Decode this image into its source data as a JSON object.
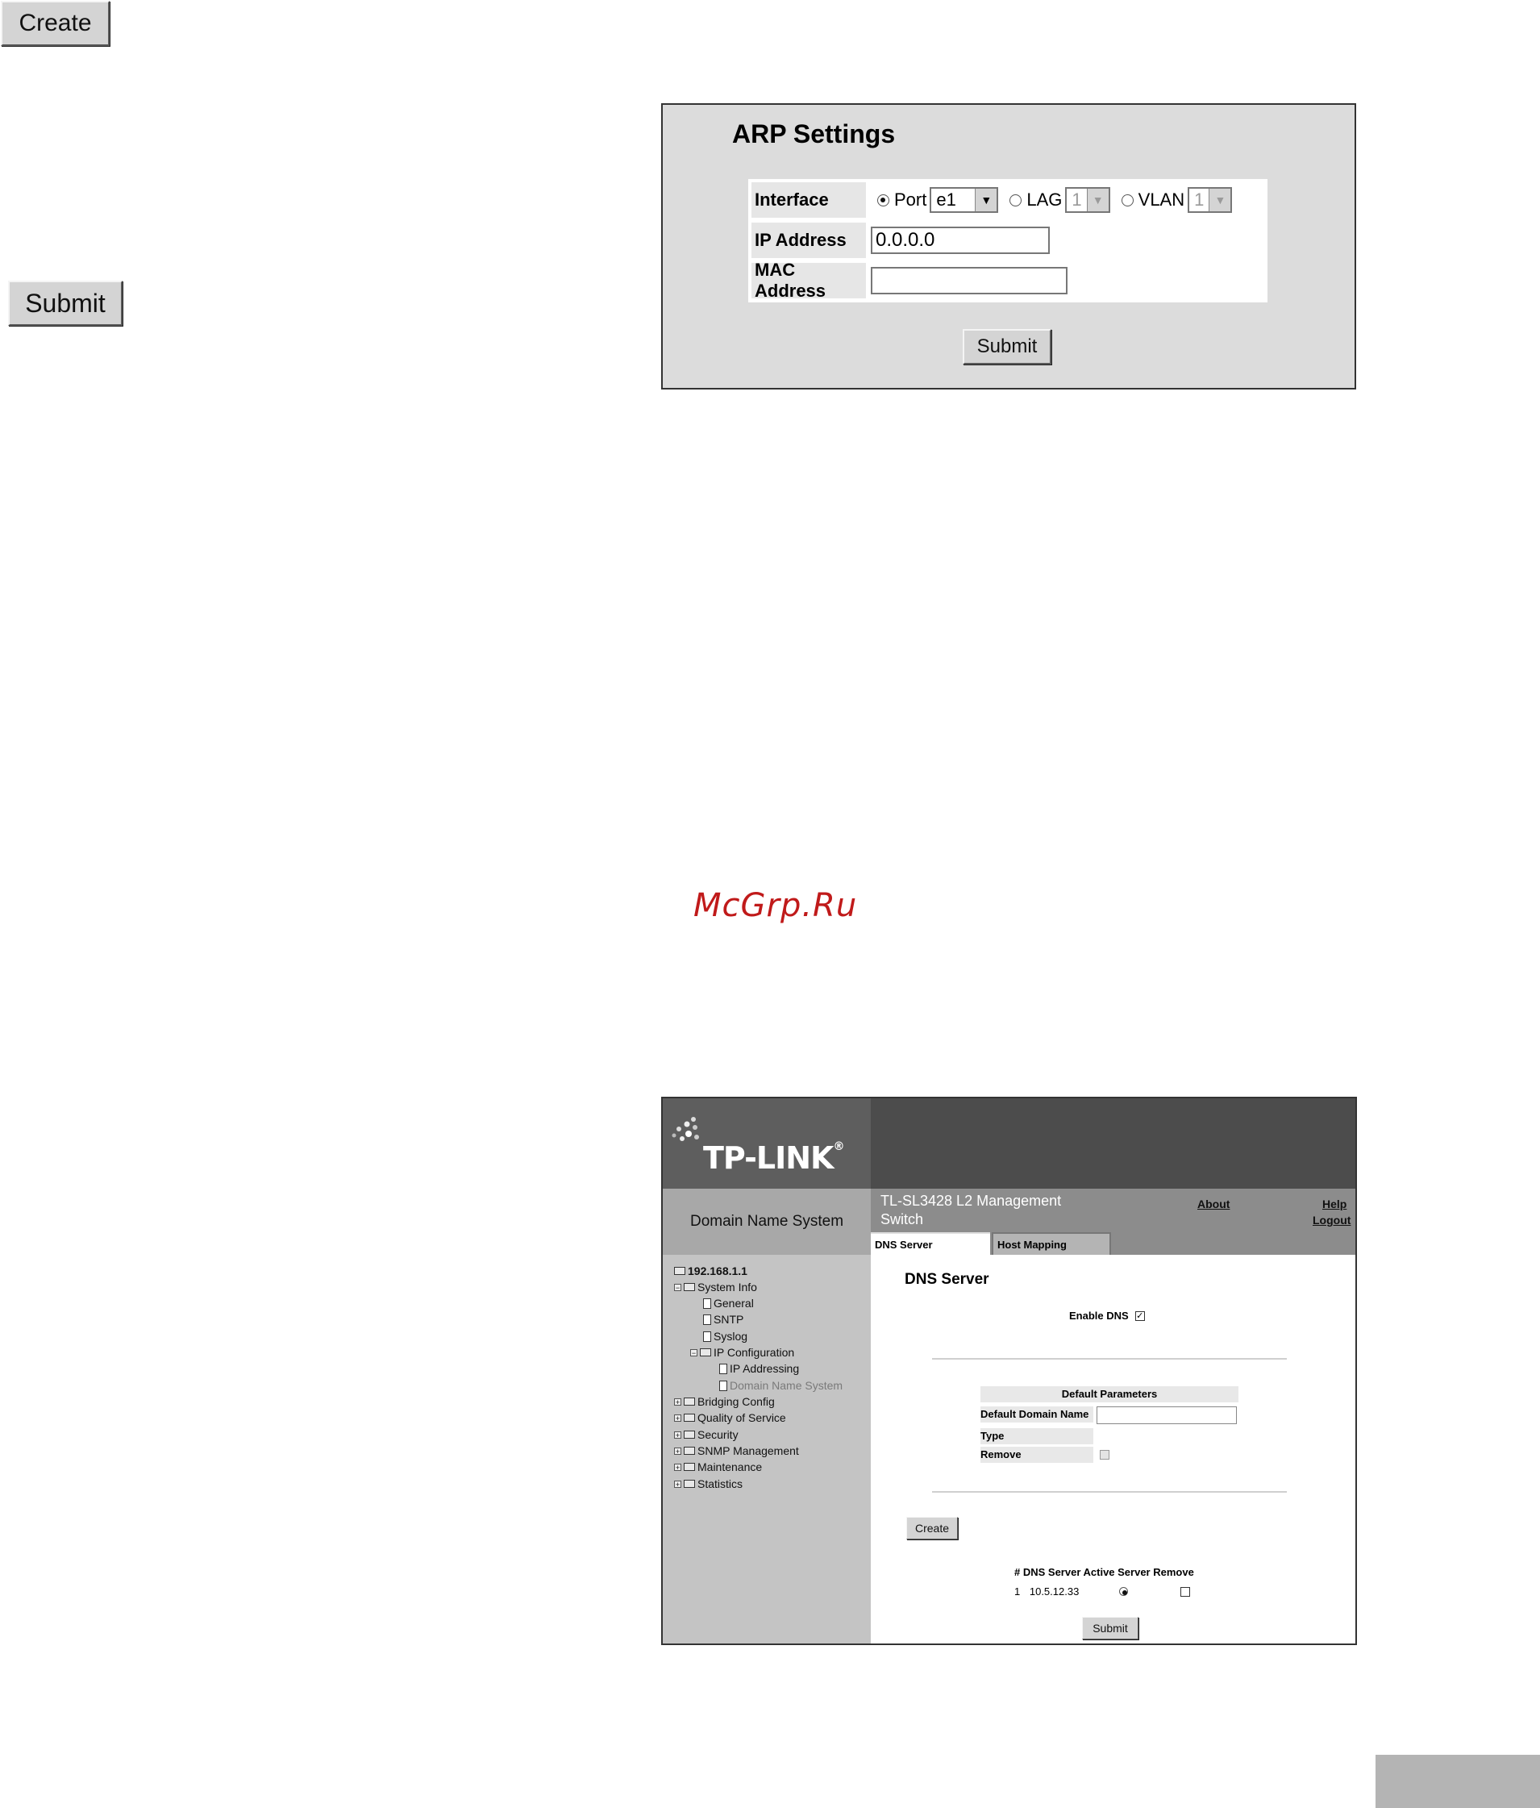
{
  "top_buttons": {
    "create": "Create",
    "submit": "Submit"
  },
  "arp": {
    "title": "ARP Settings",
    "labels": {
      "interface": "Interface",
      "ip": "IP Address",
      "mac": "MAC Address"
    },
    "port_label": "Port",
    "port_value": "e1",
    "lag_label": "LAG",
    "lag_value": "1",
    "vlan_label": "VLAN",
    "vlan_value": "1",
    "ip_value": "0.0.0.0",
    "mac_value": "",
    "submit": "Submit"
  },
  "watermark": "McGrp.Ru",
  "tplink": {
    "logo": "TP-LINK",
    "section": "Domain Name System",
    "product": "TL-SL3428 L2 Management Switch",
    "links": {
      "about": "About",
      "help": "Help",
      "logout": "Logout"
    },
    "tabs": [
      "DNS Server",
      "Host Mapping"
    ],
    "tree": [
      "192.168.1.1",
      "System Info",
      "General",
      "SNTP",
      "Syslog",
      "IP Configuration",
      "IP Addressing",
      "Domain Name System",
      "Bridging Config",
      "Quality of Service",
      "Security",
      "SNMP Management",
      "Maintenance",
      "Statistics"
    ],
    "main_title": "DNS Server",
    "enable_dns": "Enable DNS",
    "params": {
      "title": "Default Parameters",
      "domain_label": "Default Domain Name",
      "type_label": "Type",
      "remove_label": "Remove"
    },
    "create": "Create",
    "list_header": "# DNS Server Active Server Remove",
    "list_row": {
      "index": "1",
      "server": "10.5.12.33"
    },
    "submit": "Submit"
  }
}
